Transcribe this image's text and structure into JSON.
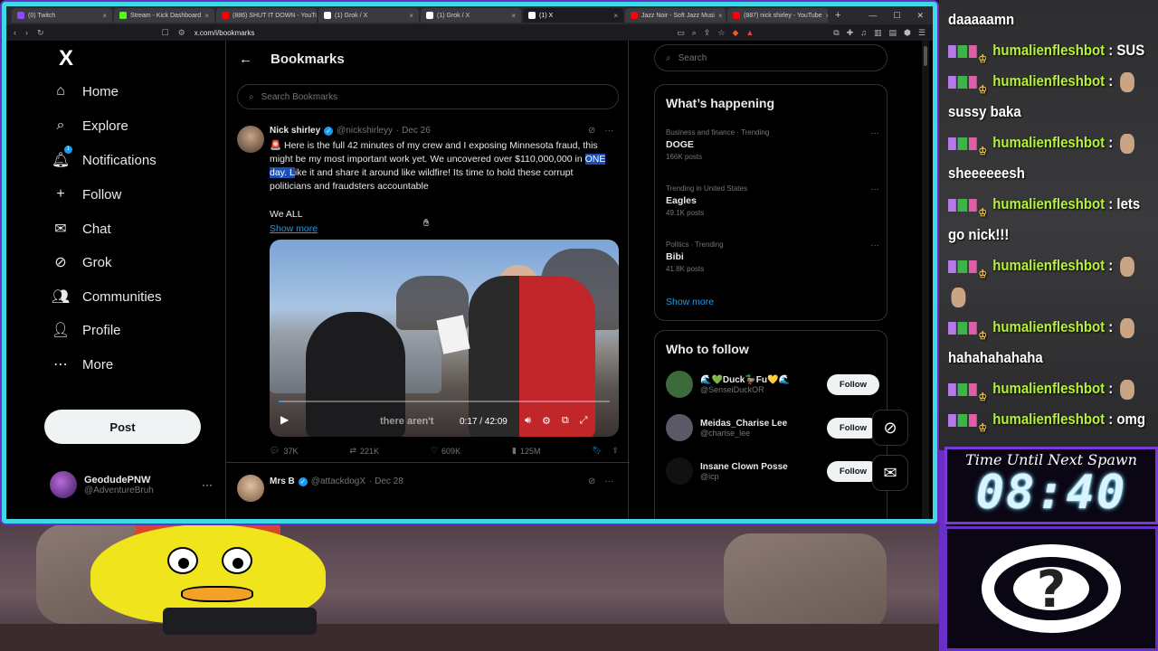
{
  "browser": {
    "tabs": [
      {
        "label": "(0) Twitch",
        "color": "#9146ff"
      },
      {
        "label": "Stream - Kick Dashboard",
        "color": "#53fc18"
      },
      {
        "label": "(886) SHUT IT DOWN - YouTu",
        "color": "#ff0000"
      },
      {
        "label": "(1) Grok / X",
        "color": "#ffffff"
      },
      {
        "label": "(1) Grok / X",
        "color": "#ffffff"
      },
      {
        "label": "(1) X",
        "color": "#ffffff",
        "active": true
      },
      {
        "label": "Jazz Noir - Soft Jazz Musi",
        "color": "#ff0000"
      },
      {
        "label": "(887) nick shirley - YouTube",
        "color": "#ff0000"
      }
    ],
    "url": "x.com/i/bookmarks"
  },
  "nav": {
    "logo": "X",
    "items": [
      {
        "label": "Home",
        "icon": "⌂"
      },
      {
        "label": "Explore",
        "icon": "⌕"
      },
      {
        "label": "Notifications",
        "icon": "🔔︎",
        "badge": "1"
      },
      {
        "label": "Follow",
        "icon": "+"
      },
      {
        "label": "Chat",
        "icon": "✉"
      },
      {
        "label": "Grok",
        "icon": "⊘"
      },
      {
        "label": "Communities",
        "icon": "👥︎"
      },
      {
        "label": "Profile",
        "icon": "👤︎"
      },
      {
        "label": "More",
        "icon": "⋯"
      }
    ],
    "post_label": "Post",
    "account": {
      "name": "GeodudePNW",
      "handle": "@AdventureBruh"
    }
  },
  "main": {
    "title": "Bookmarks",
    "search_placeholder": "Search Bookmarks",
    "tweet": {
      "name": "Nick shirley",
      "handle": "@nickshirleyy",
      "date": "· Dec 26",
      "text_1": "🚨 Here is the full 42 minutes of my crew and I exposing Minnesota fraud, this might be my most important work yet. We uncovered over $110,000,000 in ",
      "text_hl": "ONE day. L",
      "text_2": "ike it and share it around like wildfire! Its time to hold these corrupt politicians and fraudsters accountable",
      "text_extra": "We ALL",
      "show_more": "Show more",
      "video": {
        "caption": "there aren't",
        "time": "0:17 / 42:09",
        "progress": 0.007
      },
      "stats": {
        "replies": "37K",
        "reposts": "221K",
        "likes": "609K",
        "views": "125M"
      }
    },
    "tweet2": {
      "name": "Mrs B",
      "handle": "@attackdogX",
      "date": "· Dec 28"
    }
  },
  "sidebar": {
    "search_placeholder": "Search",
    "happening_title": "What’s happening",
    "trends": [
      {
        "category": "Business and finance · Trending",
        "name": "DOGE",
        "count": "166K posts"
      },
      {
        "category": "Trending in United States",
        "name": "Eagles",
        "count": "49.1K posts"
      },
      {
        "category": "Politics · Trending",
        "name": "Bibi",
        "count": "41.8K posts"
      }
    ],
    "show_more": "Show more",
    "wtf_title": "Who to follow",
    "follow": [
      {
        "name": "🌊💚Duck🦆Fu💛🌊",
        "handle": "@SenseiDuckOR",
        "button": "Follow",
        "color": "#3d6a3a"
      },
      {
        "name": "Meidas_Charise Lee",
        "handle": "@charise_lee",
        "button": "Follow",
        "color": "#5a5a66"
      },
      {
        "name": "Insane Clown Posse",
        "handle": "@icp",
        "button": "Follow",
        "color": "#111111"
      }
    ]
  },
  "chat": {
    "messages": [
      {
        "text": "daaaaamn",
        "user": ""
      },
      {
        "user": "humalienfleshbot",
        "text": "SUS"
      },
      {
        "user": "humalienfleshbot",
        "text": ""
      },
      {
        "user": "",
        "text": "sussy baka"
      },
      {
        "user": "humalienfleshbot",
        "text": ""
      },
      {
        "user": "",
        "text": "sheeeeeesh"
      },
      {
        "user": "humalienfleshbot",
        "text": "lets"
      },
      {
        "user": "",
        "text": "go nick!!!"
      },
      {
        "user": "humalienfleshbot",
        "text": ""
      },
      {
        "user": "",
        "text": ""
      },
      {
        "user": "humalienfleshbot",
        "text": ""
      },
      {
        "user": "",
        "text": "hahahahahaha"
      },
      {
        "user": "humalienfleshbot",
        "text": ""
      },
      {
        "user": "humalienfleshbot",
        "text": "omg"
      }
    ]
  },
  "timer": {
    "label": "Time Until Next Spawn",
    "value": "08:40"
  }
}
